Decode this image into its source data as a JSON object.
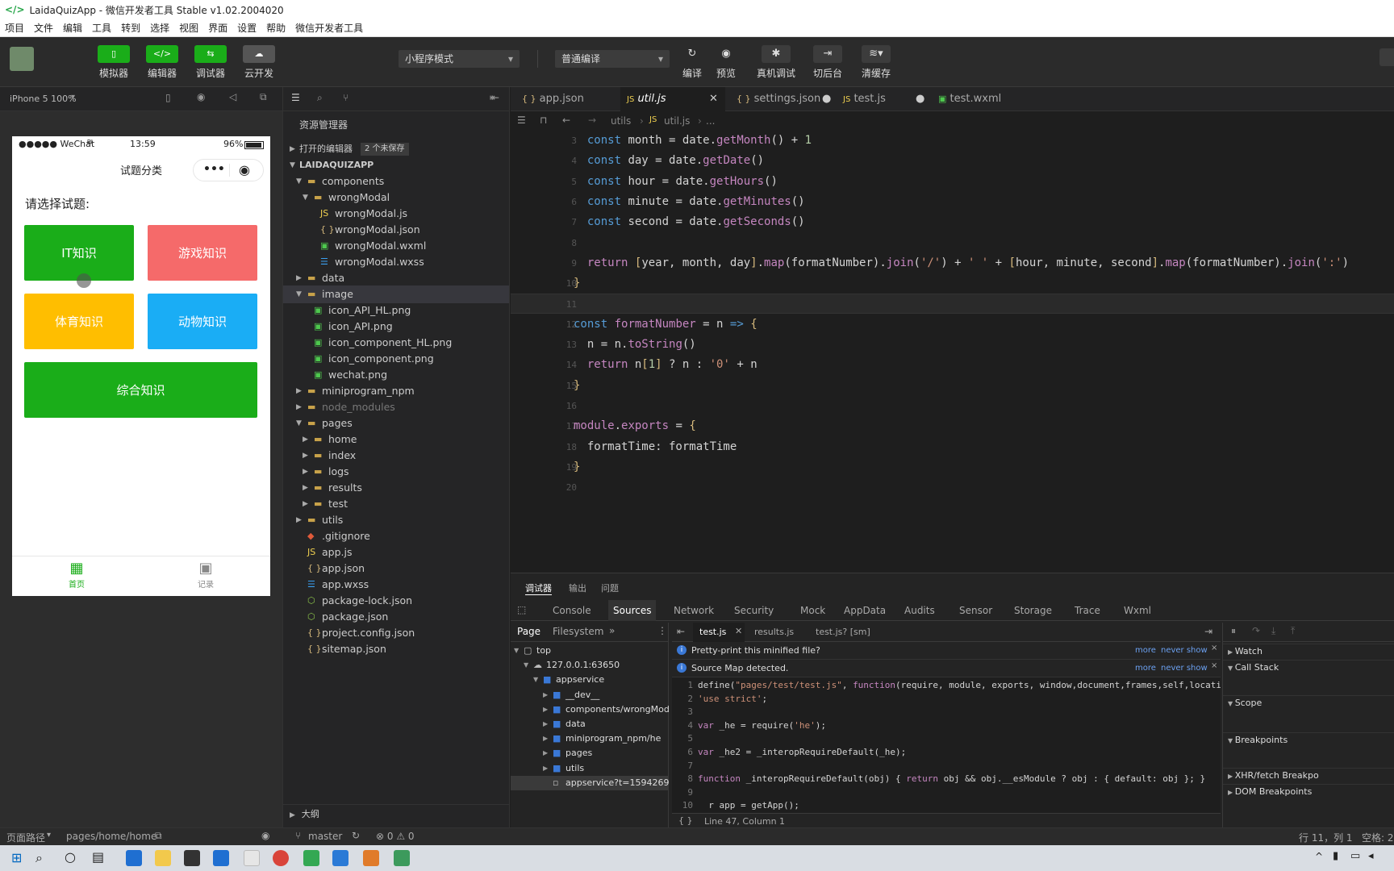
{
  "window": {
    "title": "LaidaQuizApp - 微信开发者工具 Stable v1.02.2004020"
  },
  "menu": [
    "项目",
    "文件",
    "编辑",
    "工具",
    "转到",
    "选择",
    "视图",
    "界面",
    "设置",
    "帮助",
    "微信开发者工具"
  ],
  "toolbar": {
    "simulator": "模拟器",
    "editor": "编辑器",
    "debugger": "调试器",
    "cloud": "云开发",
    "mode_select": "小程序模式",
    "compile_select": "普通编译",
    "compile": "编译",
    "preview": "预览",
    "remote_debug": "真机调试",
    "background": "切后台",
    "clear_cache": "清缓存"
  },
  "simulator": {
    "device": "iPhone 5 100%",
    "status_carrier": "●●●●● WeChat",
    "status_time": "13:59",
    "status_battery": "96%",
    "nav_title": "试题分类",
    "prompt": "请选择试题:",
    "buttons": [
      {
        "label": "IT知识",
        "color": "#1aad19"
      },
      {
        "label": "游戏知识",
        "color": "#f56a6a"
      },
      {
        "label": "体育知识",
        "color": "#ffbe00"
      },
      {
        "label": "动物知识",
        "color": "#1aadf5"
      },
      {
        "label": "综合知识",
        "color": "#1aad19"
      }
    ],
    "tabbar": [
      {
        "label": "首页",
        "active": true
      },
      {
        "label": "记录",
        "active": false
      }
    ]
  },
  "explorer": {
    "title": "资源管理器",
    "open_editors": "打开的编辑器",
    "unsaved_badge": "2 个未保存",
    "project": "LAIDAQUIZAPP",
    "items": [
      {
        "name": "components",
        "type": "folder",
        "level": 1,
        "open": true
      },
      {
        "name": "wrongModal",
        "type": "folder",
        "level": 2,
        "open": true
      },
      {
        "name": "wrongModal.js",
        "type": "js",
        "level": 3
      },
      {
        "name": "wrongModal.json",
        "type": "json",
        "level": 3
      },
      {
        "name": "wrongModal.wxml",
        "type": "wxml",
        "level": 3
      },
      {
        "name": "wrongModal.wxss",
        "type": "wxss",
        "level": 3
      },
      {
        "name": "data",
        "type": "folder",
        "level": 1,
        "open": false
      },
      {
        "name": "image",
        "type": "folder",
        "level": 1,
        "open": true,
        "selected": true
      },
      {
        "name": "icon_API_HL.png",
        "type": "png",
        "level": 2
      },
      {
        "name": "icon_API.png",
        "type": "png",
        "level": 2
      },
      {
        "name": "icon_component_HL.png",
        "type": "png",
        "level": 2
      },
      {
        "name": "icon_component.png",
        "type": "png",
        "level": 2
      },
      {
        "name": "wechat.png",
        "type": "png",
        "level": 2
      },
      {
        "name": "miniprogram_npm",
        "type": "folder",
        "level": 1,
        "open": false
      },
      {
        "name": "node_modules",
        "type": "folder",
        "level": 1,
        "open": false,
        "dim": true
      },
      {
        "name": "pages",
        "type": "folder",
        "level": 1,
        "open": true
      },
      {
        "name": "home",
        "type": "folder",
        "level": 2,
        "open": false
      },
      {
        "name": "index",
        "type": "folder",
        "level": 2,
        "open": false
      },
      {
        "name": "logs",
        "type": "folder",
        "level": 2,
        "open": false
      },
      {
        "name": "results",
        "type": "folder",
        "level": 2,
        "open": false
      },
      {
        "name": "test",
        "type": "folder",
        "level": 2,
        "open": false
      },
      {
        "name": "utils",
        "type": "folder",
        "level": 1,
        "open": false
      },
      {
        "name": ".gitignore",
        "type": "git",
        "level": 1
      },
      {
        "name": "app.js",
        "type": "js",
        "level": 1
      },
      {
        "name": "app.json",
        "type": "json",
        "level": 1
      },
      {
        "name": "app.wxss",
        "type": "wxss",
        "level": 1
      },
      {
        "name": "package-lock.json",
        "type": "pkg",
        "level": 1
      },
      {
        "name": "package.json",
        "type": "pkg",
        "level": 1
      },
      {
        "name": "project.config.json",
        "type": "json",
        "level": 1
      },
      {
        "name": "sitemap.json",
        "type": "json",
        "level": 1
      }
    ],
    "outline": "大纲"
  },
  "tabs": [
    {
      "label": "app.json",
      "icon": "{ }",
      "active": false,
      "dirty": false
    },
    {
      "label": "util.js",
      "icon": "JS",
      "active": true,
      "dirty": false
    },
    {
      "label": "settings.json",
      "icon": "{ }",
      "active": false,
      "dirty": true
    },
    {
      "label": "test.js",
      "icon": "JS",
      "active": false,
      "dirty": true
    },
    {
      "label": "test.wxml",
      "icon": "▣",
      "active": false,
      "dirty": false
    }
  ],
  "breadcrumb": [
    "utils",
    "util.js",
    "..."
  ],
  "code": [
    {
      "ln": "3",
      "html": "  <span class='kb'>const</span> month = date.<span class='fn'>getMonth</span>() + <span class='nm2'>1</span>"
    },
    {
      "ln": "4",
      "html": "  <span class='kb'>const</span> day = date.<span class='fn'>getDate</span>()"
    },
    {
      "ln": "5",
      "html": "  <span class='kb'>const</span> hour = date.<span class='fn'>getHours</span>()"
    },
    {
      "ln": "6",
      "html": "  <span class='kb'>const</span> minute = date.<span class='fn'>getMinutes</span>()"
    },
    {
      "ln": "7",
      "html": "  <span class='kb'>const</span> second = date.<span class='fn'>getSeconds</span>()"
    },
    {
      "ln": "8",
      "html": ""
    },
    {
      "ln": "9",
      "html": "  <span class='kw'>return</span> <span class='br'>[</span>year, month, day<span class='br'>]</span>.<span class='fn'>map</span>(formatNumber).<span class='fn'>join</span>(<span class='st'>'/'</span>) + <span class='st'>' '</span> + <span class='br'>[</span>hour, minute, second<span class='br'>]</span>.<span class='fn'>map</span>(formatNumber).<span class='fn'>join</span>(<span class='st'>':'</span>)"
    },
    {
      "ln": "10",
      "html": "<span class='br'>}</span>"
    },
    {
      "ln": "11",
      "html": "",
      "highlight": true
    },
    {
      "ln": "12",
      "html": "<span class='kb'>const</span> <span class='fn'>formatNumber</span> = n <span class='kb'>=&gt;</span> <span class='br'>{</span>"
    },
    {
      "ln": "13",
      "html": "  n = n.<span class='fn'>toString</span>()"
    },
    {
      "ln": "14",
      "html": "  <span class='kw'>return</span> n<span class='br'>[</span><span class='nm2'>1</span><span class='br'>]</span> ? n : <span class='st'>'0'</span> + n"
    },
    {
      "ln": "15",
      "html": "<span class='br'>}</span>"
    },
    {
      "ln": "16",
      "html": ""
    },
    {
      "ln": "17",
      "html": "<span class='fn'>module</span>.<span class='fn'>exports</span> = <span class='br'>{</span>"
    },
    {
      "ln": "18",
      "html": "  formatTime: formatTime"
    },
    {
      "ln": "19",
      "html": "<span class='br'>}</span>"
    },
    {
      "ln": "20",
      "html": ""
    }
  ],
  "devtools": {
    "top_tabs": [
      "调试器",
      "输出",
      "问题"
    ],
    "panels": [
      "Console",
      "Sources",
      "Network",
      "Security",
      "Mock",
      "AppData",
      "Audits",
      "Sensor",
      "Storage",
      "Trace",
      "Wxml"
    ],
    "active_panel": "Sources",
    "nav_tabs": [
      "Page",
      "Filesystem"
    ],
    "file_tree": [
      {
        "name": "top",
        "level": 0,
        "kind": "frame"
      },
      {
        "name": "127.0.0.1:63650",
        "level": 1,
        "kind": "cloud"
      },
      {
        "name": "appservice",
        "level": 2,
        "kind": "folder",
        "open": true
      },
      {
        "name": "__dev__",
        "level": 3,
        "kind": "folder"
      },
      {
        "name": "components/wrongModal",
        "level": 3,
        "kind": "folder"
      },
      {
        "name": "data",
        "level": 3,
        "kind": "folder"
      },
      {
        "name": "miniprogram_npm/he",
        "level": 3,
        "kind": "folder"
      },
      {
        "name": "pages",
        "level": 3,
        "kind": "folder"
      },
      {
        "name": "utils",
        "level": 3,
        "kind": "folder"
      },
      {
        "name": "appservice?t=1594269470",
        "level": 3,
        "kind": "file",
        "selected": true
      }
    ],
    "source_tabs": [
      {
        "label": "test.js",
        "active": true
      },
      {
        "label": "results.js",
        "active": false
      },
      {
        "label": "test.js? [sm]",
        "active": false
      }
    ],
    "info1": "Pretty-print this minified file?",
    "info2": "Source Map detected.",
    "more": "more",
    "never_show": "never show",
    "source_lines": [
      {
        "ln": "1",
        "html": "define(<span style='color:#ce9178'>\"pages/test/test.js\"</span>, <span style='color:#c586c0'>function</span>(require, module, exports, window,document,frames,self,location,naviga"
      },
      {
        "ln": "2",
        "html": "<span style='color:#ce9178'>'use strict'</span>;"
      },
      {
        "ln": "3",
        "html": ""
      },
      {
        "ln": "4",
        "html": "<span style='color:#c586c0'>var</span> _he = require(<span style='color:#ce9178'>'he'</span>);"
      },
      {
        "ln": "5",
        "html": ""
      },
      {
        "ln": "6",
        "html": "<span style='color:#c586c0'>var</span> _he2 = _interopRequireDefault(_he);"
      },
      {
        "ln": "7",
        "html": ""
      },
      {
        "ln": "8",
        "html": "<span style='color:#c586c0'>function</span> _interopRequireDefault(obj) { <span style='color:#c586c0'>return</span> obj &amp;&amp; obj.__esModule ? obj : { default: obj }; }"
      },
      {
        "ln": "9",
        "html": ""
      },
      {
        "ln": "10",
        "html": "  r app = getApp();"
      }
    ],
    "position": "Line 47, Column 1",
    "right_sections": [
      "Watch",
      "Call Stack",
      "Scope",
      "Breakpoints",
      "XHR/fetch Breakpo",
      "DOM Breakpoints"
    ]
  },
  "status": {
    "page_path_label": "页面路径",
    "page_path": "pages/home/home",
    "branch": "master",
    "errors": "⊗ 0 ⚠ 0",
    "cursor": "行 11，列 1",
    "spaces": "空格: 2"
  },
  "colors": {
    "accent": "#1aad19",
    "tab_active_bg": "#1e1e1e"
  }
}
